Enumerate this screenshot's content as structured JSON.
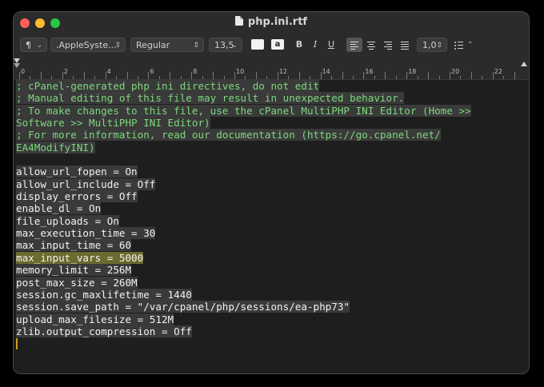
{
  "window": {
    "title": "php.ini.rtf"
  },
  "toolbar": {
    "paragraph_style": "¶",
    "font_family": ".AppleSyste...",
    "font_style": "Regular",
    "font_size": "13,5",
    "highlight_glyph": "a",
    "bold": "B",
    "italic": "I",
    "underline": "U",
    "line_spacing": "1,0",
    "text_color": "#f2f2f2"
  },
  "ruler": {
    "labels": [
      "0",
      "2",
      "4",
      "6",
      "8",
      "10",
      "12",
      "14",
      "16",
      "18",
      "20",
      "22"
    ]
  },
  "document": {
    "comment_color": "#7dd87d",
    "selected_line": "max_input_vars = 5000",
    "lines": [
      {
        "text": "; cPanel-generated php ini directives, do not edit",
        "kind": "comment"
      },
      {
        "text": "; Manual editing of this file may result in unexpected behavior.",
        "kind": "comment"
      },
      {
        "text": "; To make changes to this file, use the cPanel MultiPHP INI Editor (Home >>",
        "kind": "comment"
      },
      {
        "text": "Software >> MultiPHP INI Editor)",
        "kind": "comment"
      },
      {
        "text": "; For more information, read our documentation (https://go.cpanel.net/",
        "kind": "comment"
      },
      {
        "text": "EA4ModifyINI)",
        "kind": "comment"
      },
      {
        "text": "",
        "kind": "blank"
      },
      {
        "text": "allow_url_fopen = On",
        "kind": "code"
      },
      {
        "text": "allow_url_include = Off",
        "kind": "code"
      },
      {
        "text": "display_errors = Off",
        "kind": "code"
      },
      {
        "text": "enable_dl = On",
        "kind": "code"
      },
      {
        "text": "file_uploads = On",
        "kind": "code"
      },
      {
        "text": "max_execution_time = 30",
        "kind": "code"
      },
      {
        "text": "max_input_time = 60",
        "kind": "code"
      },
      {
        "text": "max_input_vars = 5000",
        "kind": "selected"
      },
      {
        "text": "memory_limit = 256M",
        "kind": "code"
      },
      {
        "text": "post_max_size = 260M",
        "kind": "code"
      },
      {
        "text": "session.gc_maxlifetime = 1440",
        "kind": "code"
      },
      {
        "text": "session.save_path = \"/var/cpanel/php/sessions/ea-php73\"",
        "kind": "code"
      },
      {
        "text": "upload_max_filesize = 512M",
        "kind": "code"
      },
      {
        "text": "zlib.output_compression = Off",
        "kind": "code"
      }
    ]
  }
}
